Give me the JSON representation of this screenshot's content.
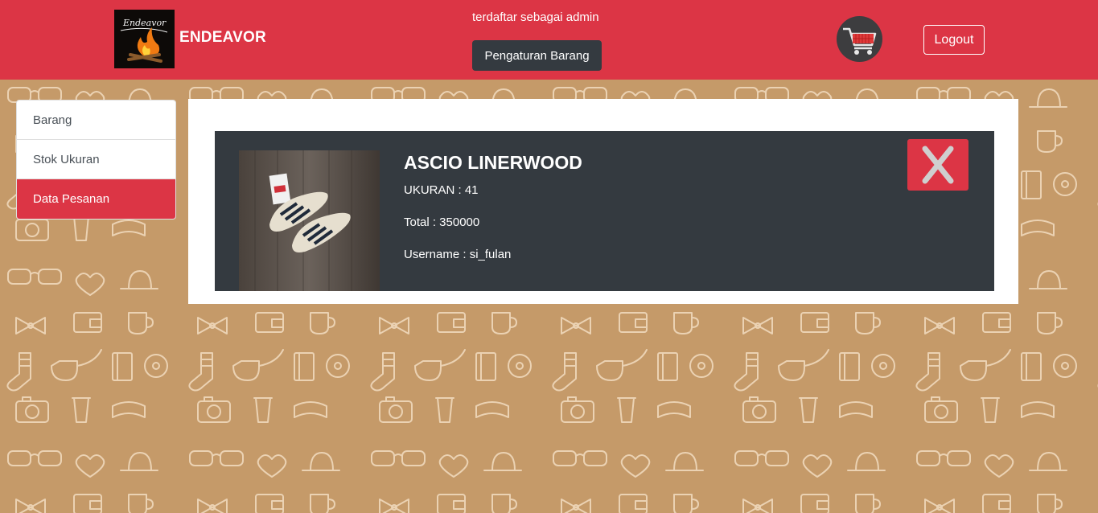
{
  "header": {
    "brand_logo_text": "Endeavor",
    "brand_name": "ENDEAVOR",
    "status_text": "terdaftar sebagai admin",
    "admin_button_label": "Pengaturan Barang",
    "cart_icon": "shopping-cart-icon",
    "logout_label": "Logout"
  },
  "sidebar": {
    "items": [
      {
        "label": "Barang",
        "active": false
      },
      {
        "label": "Stok Ukuran",
        "active": false
      },
      {
        "label": "Data Pesanan",
        "active": true
      }
    ]
  },
  "order": {
    "product_name": "ASCIO LINERWOOD",
    "size_line": "UKURAN : 41",
    "total_line": "Total : 350000",
    "username_line": "Username : si_fulan",
    "delete_icon": "close-icon"
  },
  "colors": {
    "navbar": "#dc3545",
    "background": "#c59a69",
    "card_dark": "#343a40",
    "active_item": "#dc3545"
  }
}
